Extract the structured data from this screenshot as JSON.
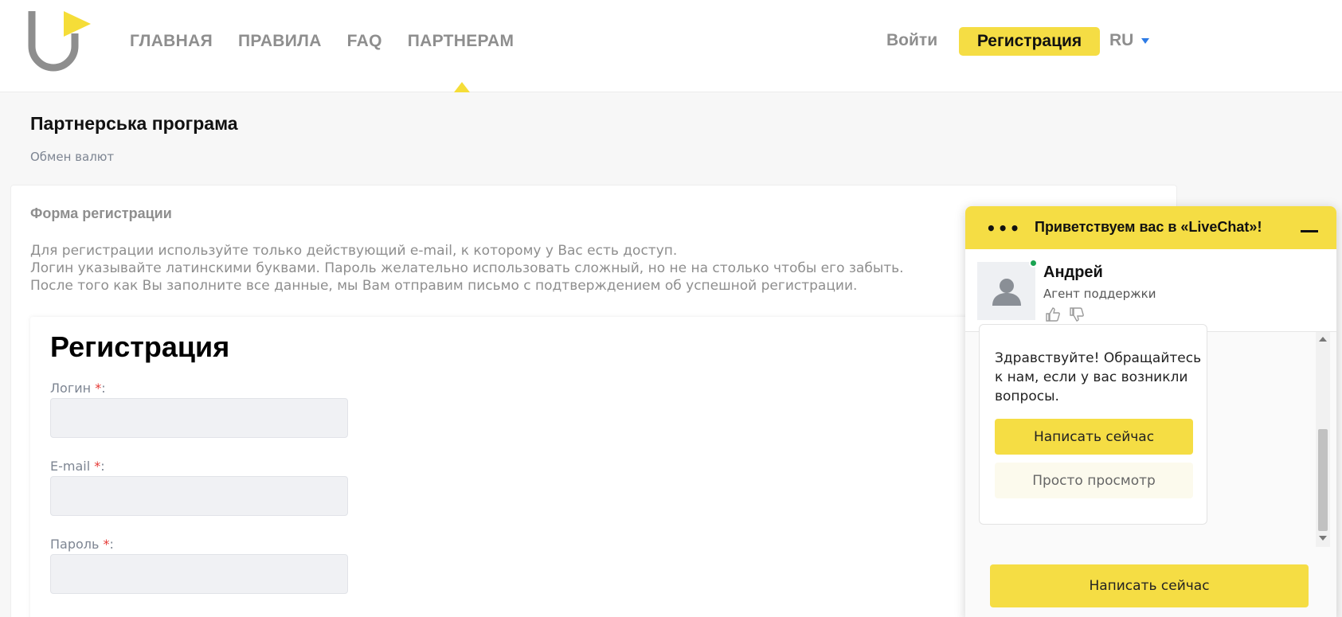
{
  "header": {
    "nav": [
      "ГЛАВНАЯ",
      "ПРАВИЛА",
      "FAQ",
      "ПАРТНЕРАМ"
    ],
    "login": "Войти",
    "register": "Регистрация",
    "lang": "RU"
  },
  "page": {
    "title": "Партнерська програма",
    "breadcrumb": "Обмен валют"
  },
  "form": {
    "heading": "Форма регистрации",
    "instructions": [
      "Для регистрации используйте только действующий e-mail, к которому у Вас есть доступ.",
      "Логин указывайте латинскими буквами. Пароль желательно использовать сложный, но не на столько чтобы его забыть.",
      "После того как Вы заполните все данные, мы Вам отправим письмо с подтверждением об успешной регистрации."
    ],
    "title": "Регистрация",
    "fields": [
      {
        "label": "Логин",
        "required": "*",
        "value": ""
      },
      {
        "label": "E-mail",
        "required": "*",
        "value": ""
      },
      {
        "label": "Пароль",
        "required": "*",
        "value": ""
      }
    ]
  },
  "chat": {
    "title": "Приветствуем вас в «LiveChat»!",
    "agent_name": "Андрей",
    "agent_role": "Агент поддержки",
    "message": "Здравствуйте! Обращайтесь к нам, если у вас возникли вопросы.",
    "btn_write": "Написать сейчас",
    "btn_browse": "Просто просмотр",
    "btn_write_bottom": "Написать сейчас",
    "colors": {
      "accent": "#f5dd44",
      "online": "#1aa352"
    }
  }
}
